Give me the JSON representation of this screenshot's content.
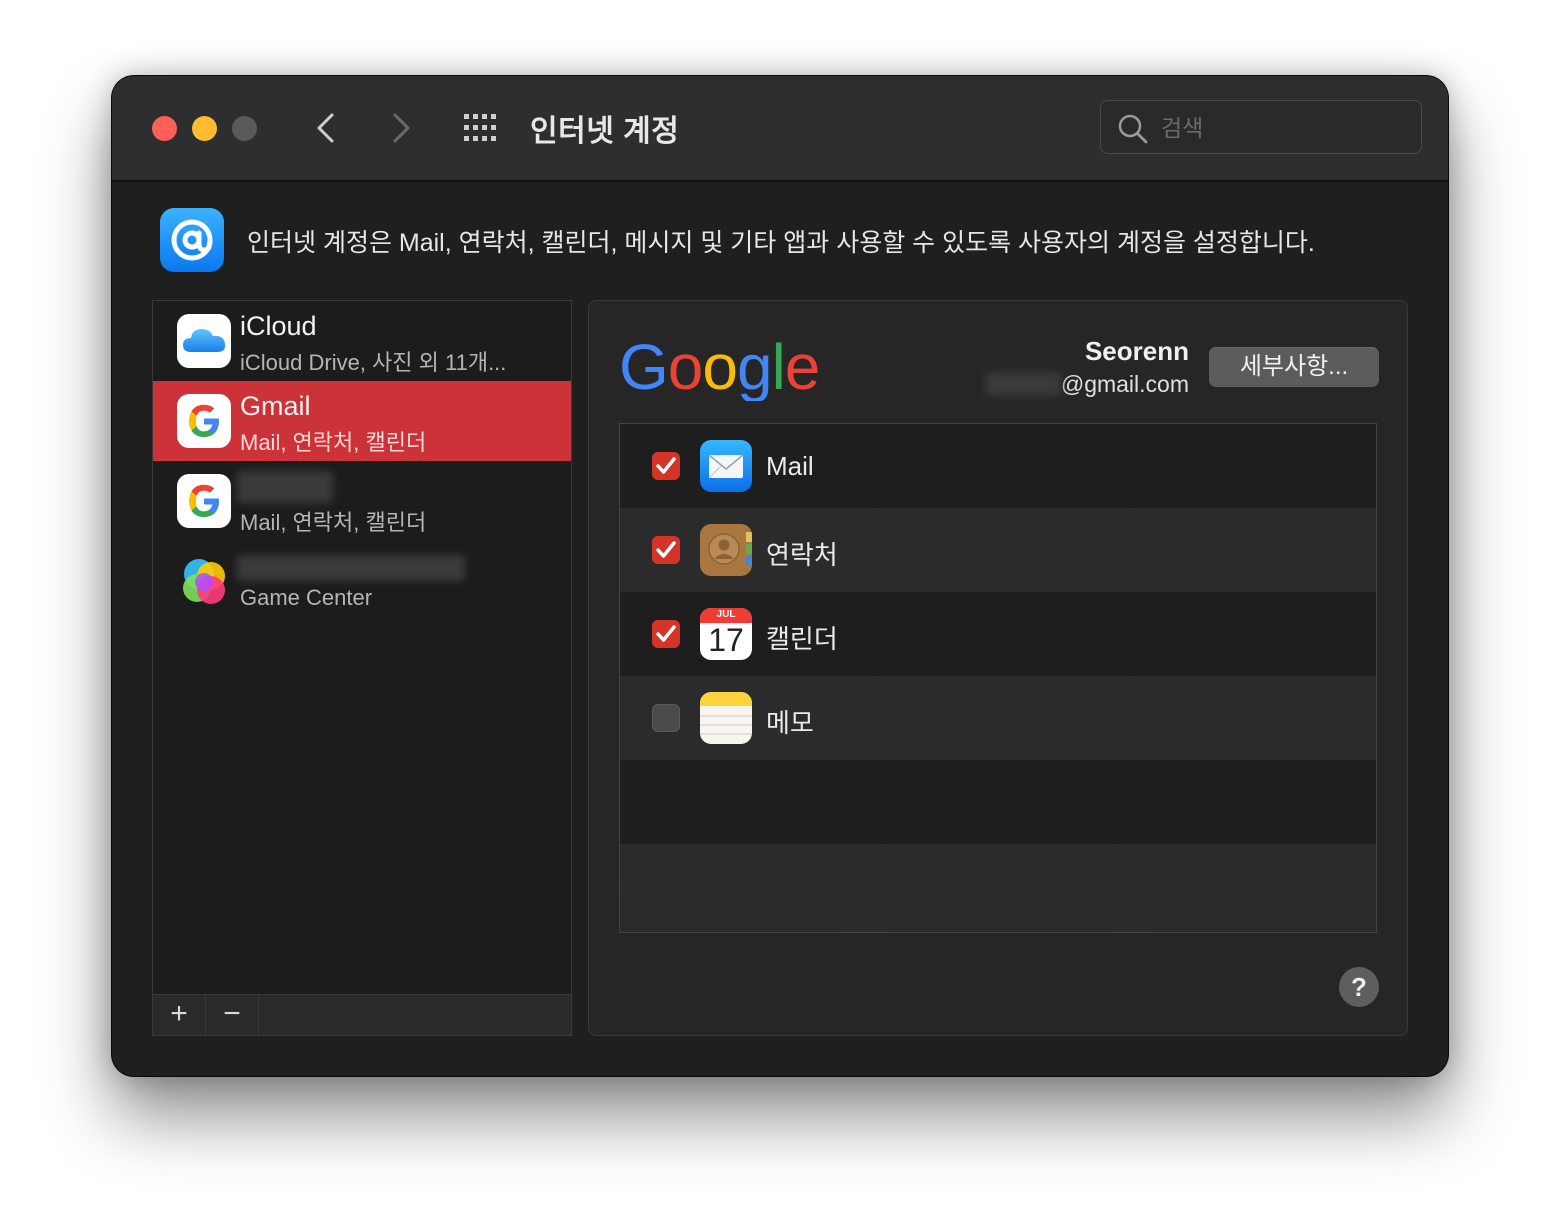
{
  "window": {
    "title": "인터넷 계정",
    "search_placeholder": "검색"
  },
  "header": {
    "description": "인터넷 계정은 Mail, 연락처, 캘린더, 메시지 및 기타 앱과 사용할 수 있도록 사용자의 계정을 설정합니다."
  },
  "accounts": [
    {
      "name": "iCloud",
      "subtitle": "iCloud Drive, 사진 외 11개...",
      "icon": "icloud-icon",
      "selected": false
    },
    {
      "name": "Gmail",
      "subtitle": "Mail, 연락처, 캘린더",
      "icon": "google-icon",
      "selected": true
    },
    {
      "name": "",
      "subtitle": "Mail, 연락처, 캘린더",
      "icon": "google-icon",
      "selected": false
    },
    {
      "name": "",
      "subtitle": "Game Center",
      "icon": "game-center-icon",
      "selected": false
    }
  ],
  "sidebar_footer": {
    "add": "+",
    "remove": "−"
  },
  "detail": {
    "provider": "Google",
    "user_name": "Seorenn",
    "user_email": "@gmail.com",
    "details_button": "세부사항...",
    "apps": [
      {
        "label": "Mail",
        "checked": true,
        "icon": "mail-icon"
      },
      {
        "label": "연락처",
        "checked": true,
        "icon": "contacts-icon"
      },
      {
        "label": "캘린더",
        "checked": true,
        "icon": "calendar-icon",
        "calendar_month": "JUL",
        "calendar_day": "17"
      },
      {
        "label": "메모",
        "checked": false,
        "icon": "notes-icon"
      }
    ],
    "help": "?"
  },
  "colors": {
    "selection": "#cc3339",
    "checkbox_on": "#d63329",
    "window_bg": "#1f1f1f"
  }
}
